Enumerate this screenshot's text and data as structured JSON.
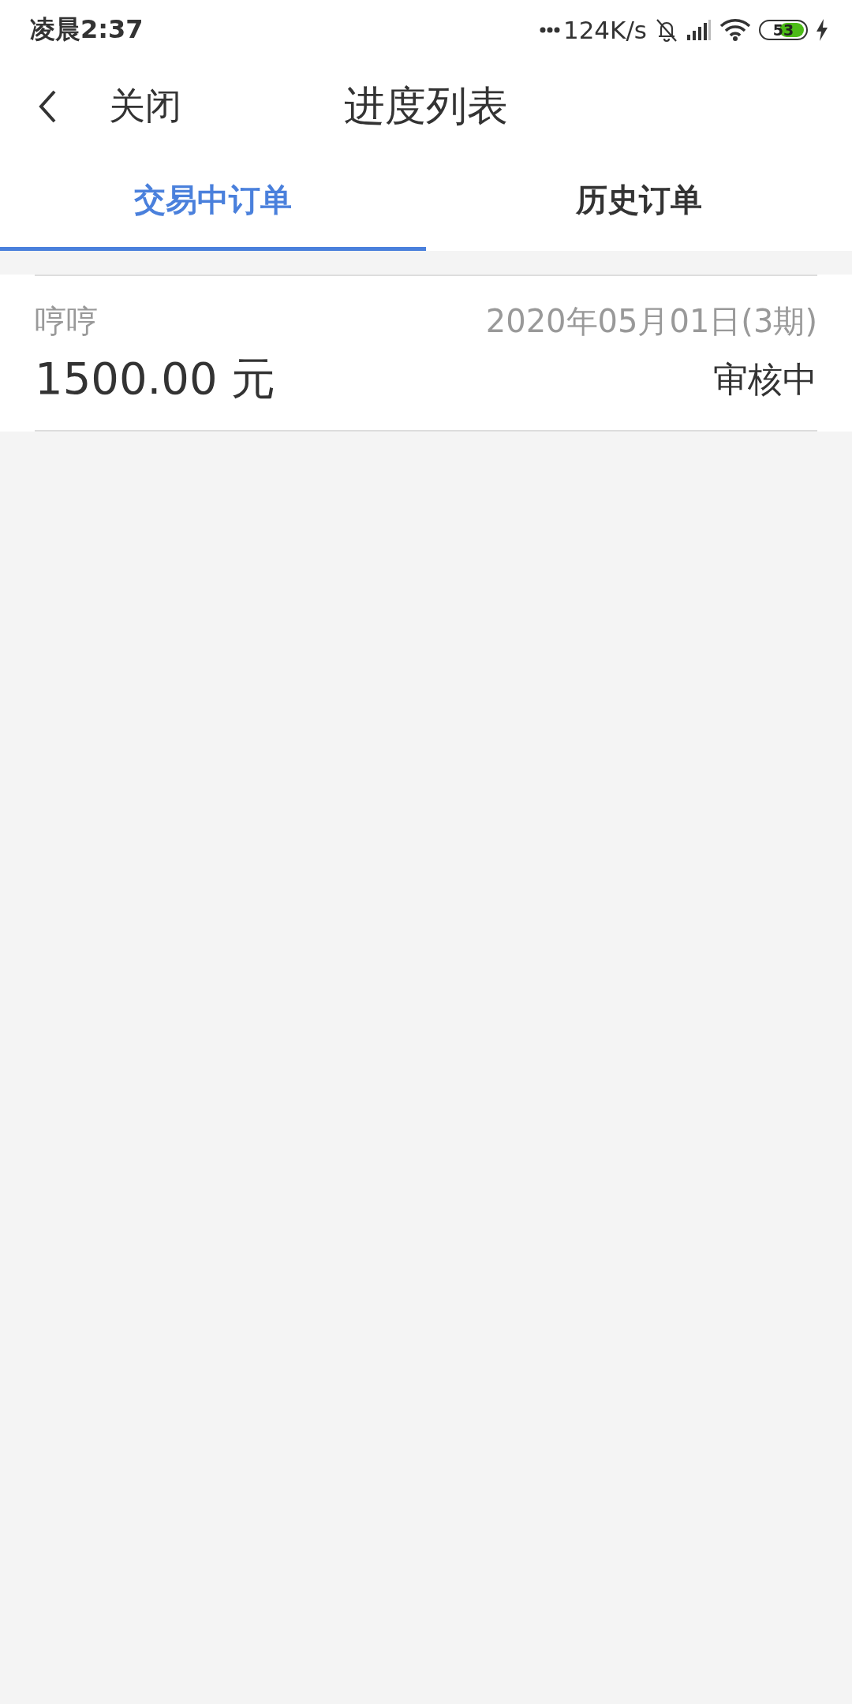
{
  "status_bar": {
    "time": "凌晨2:37",
    "net_speed": "124K/s",
    "battery": "53"
  },
  "header": {
    "close_label": "关闭",
    "title": "进度列表"
  },
  "tabs": [
    {
      "label": "交易中订单",
      "selected": true
    },
    {
      "label": "历史订单",
      "selected": false
    }
  ],
  "orders": [
    {
      "name": "哼哼",
      "date": "2020年05月01日(3期)",
      "amount": "1500.00 元",
      "status": "审核中"
    }
  ]
}
